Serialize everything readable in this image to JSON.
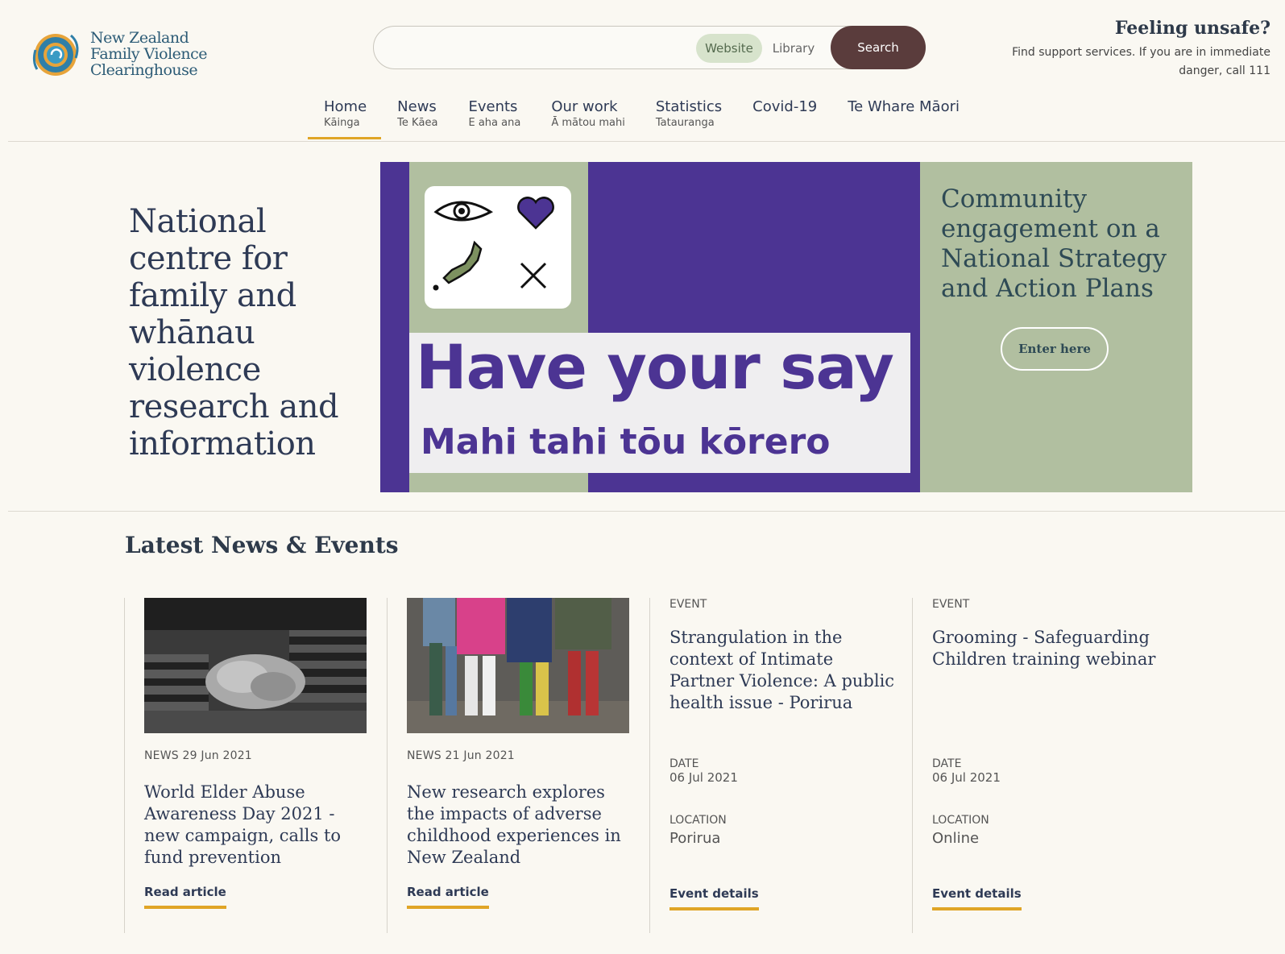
{
  "header": {
    "logo_lines": [
      "New Zealand",
      "Family Violence",
      "Clearinghouse"
    ],
    "search": {
      "placeholder": "",
      "value": "",
      "scope_website": "Website",
      "scope_library": "Library",
      "button": "Search"
    },
    "unsafe_title": "Feeling unsafe?",
    "unsafe_text": "Find support services. If you are in immediate danger, call 111"
  },
  "nav": [
    {
      "main": "Home",
      "sub": "Kāinga",
      "active": true
    },
    {
      "main": "News",
      "sub": "Te Kāea"
    },
    {
      "main": "Events",
      "sub": "E aha ana"
    },
    {
      "main": "Our work",
      "sub": "Ā mātou mahi"
    },
    {
      "main": "Statistics",
      "sub": "Tatauranga"
    },
    {
      "main": "Covid-19",
      "sub": ""
    },
    {
      "main": "Te Whare Māori",
      "sub": ""
    }
  ],
  "hero": {
    "heading": "National centre for family and whānau violence research and information",
    "banner_big": "Have your say",
    "banner_sub": "Mahi tahi tōu kōrero",
    "banner_right": "Community engagement on a National Strategy and Action Plans",
    "enter_label": "Enter here"
  },
  "latest": {
    "title": "Latest News & Events",
    "news": [
      {
        "meta": "NEWS 29 Jun 2021",
        "title": "World Elder Abuse Awareness Day 2021 - new campaign, calls to fund prevention",
        "link": "Read article"
      },
      {
        "meta": "NEWS 21 Jun 2021",
        "title": "New research explores the impacts of adverse childhood experiences in New Zealand",
        "link": "Read article"
      }
    ],
    "events": [
      {
        "tag": "EVENT",
        "title": "Strangulation in the context of Intimate Partner Violence: A public health issue - Porirua",
        "date_label": "DATE",
        "date": "06 Jul 2021",
        "location_label": "LOCATION",
        "location": "Porirua",
        "link": "Event details"
      },
      {
        "tag": "EVENT",
        "title": "Grooming - Safeguarding Children training webinar",
        "date_label": "DATE",
        "date": "06 Jul 2021",
        "location_label": "LOCATION",
        "location": "Online",
        "link": "Event details"
      }
    ]
  },
  "colors": {
    "purple": "#4c3493",
    "sage": "#b1bfa0",
    "accent_underline": "#e0a526",
    "search_button": "#5a3c3c"
  }
}
